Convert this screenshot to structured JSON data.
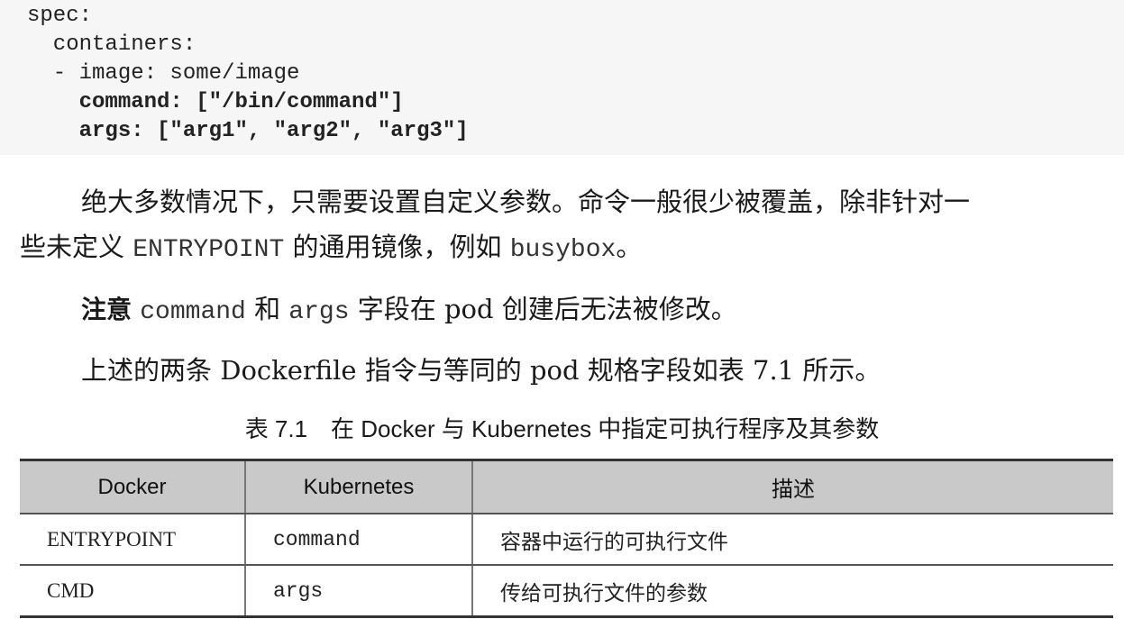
{
  "code_block": {
    "lines": [
      "spec:",
      "  containers:",
      "  - image: some/image",
      "    command: [\"/bin/command\"]",
      "    args: [\"arg1\", \"arg2\", \"arg3\"]"
    ]
  },
  "paragraph1": {
    "line1": "绝大多数情况下，只需要设置自定义参数。命令一般很少被覆盖，除非针对一",
    "line2_pre": "些未定义 ",
    "line2_code": "ENTRYPOINT",
    "line2_mid": " 的通用镜像，例如 ",
    "line2_code2": "busybox",
    "line2_end": "。"
  },
  "note": {
    "label": "注意",
    "code1": "command",
    "text1": " 和 ",
    "code2": "args",
    "text2": " 字段在 pod 创建后无法被修改。"
  },
  "paragraph2": {
    "text": "上述的两条 Dockerfile 指令与等同的 pod 规格字段如表 7.1 所示。"
  },
  "table": {
    "caption": "表 7.1　在 Docker 与 Kubernetes 中指定可执行程序及其参数",
    "headers": [
      "Docker",
      "Kubernetes",
      "描述"
    ],
    "rows": [
      [
        "ENTRYPOINT",
        "command",
        "容器中运行的可执行文件"
      ],
      [
        "CMD",
        "args",
        "传给可执行文件的参数"
      ]
    ]
  }
}
